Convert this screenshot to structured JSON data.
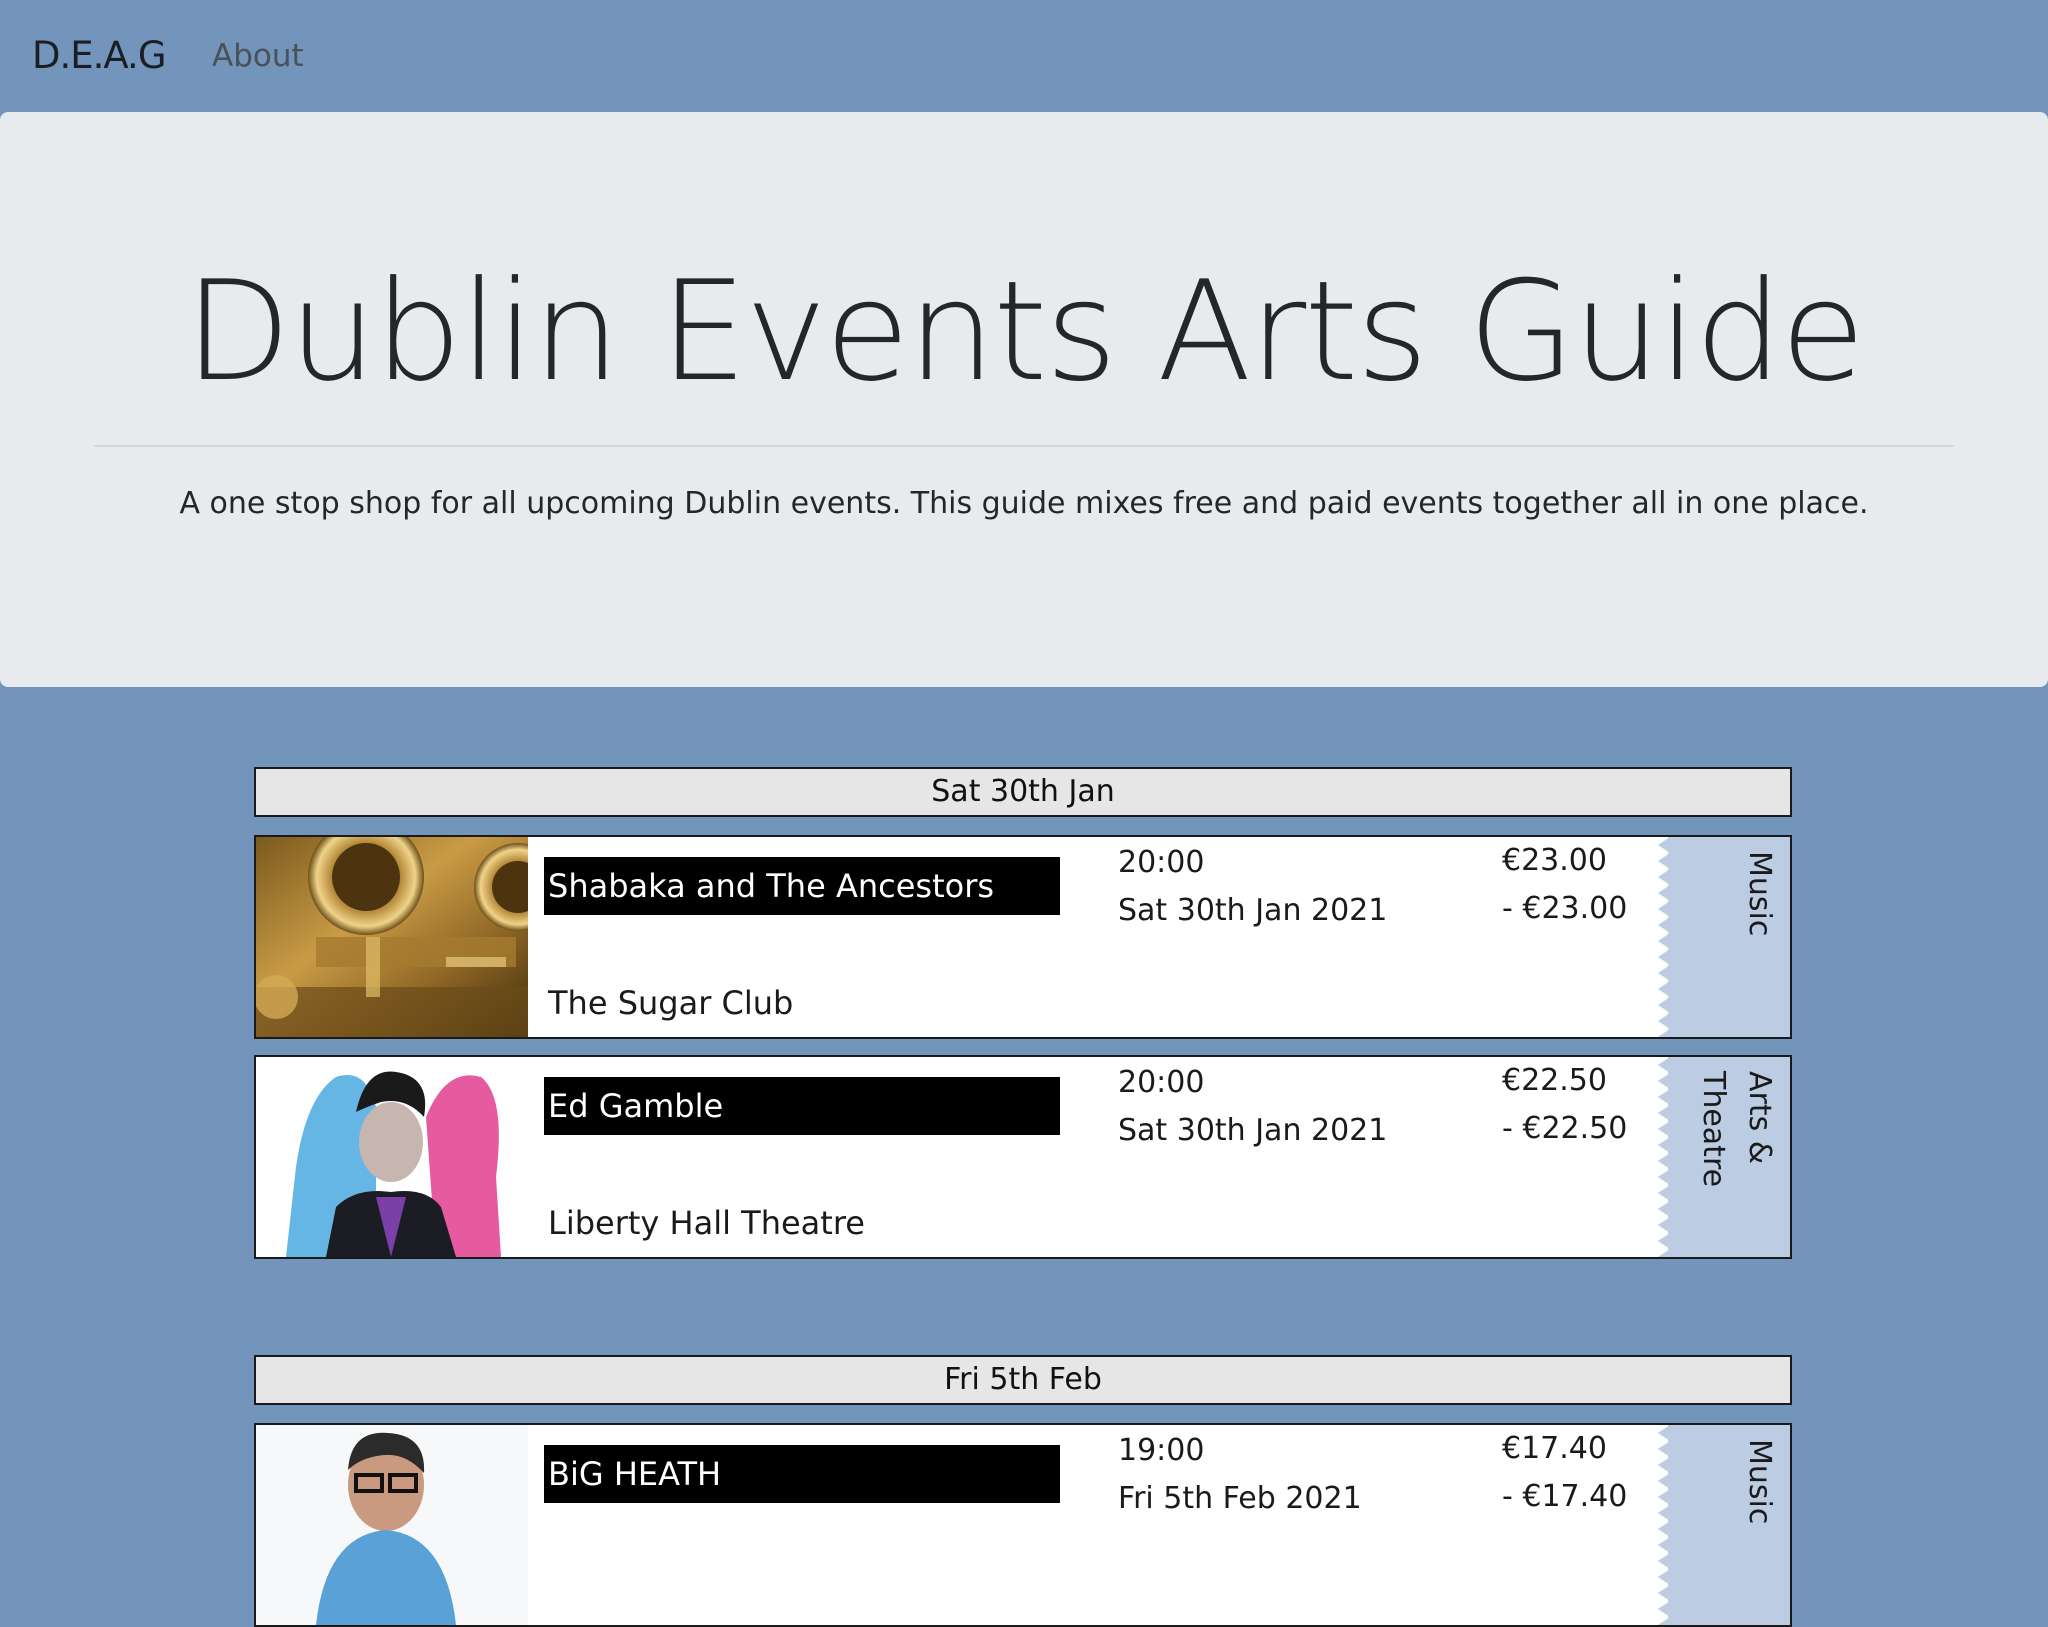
{
  "nav": {
    "brand": "D.E.A.G",
    "about": "About"
  },
  "hero": {
    "title": "Dublin Events Arts Guide",
    "lead": "A one stop shop for all upcoming Dublin events. This guide mixes free and paid events together all in one place."
  },
  "groups": [
    {
      "date_label": "Sat 30th Jan",
      "events": [
        {
          "name": "Shabaka and The Ancestors",
          "venue": "The Sugar Club",
          "time": "20:00",
          "date": "Sat 30th Jan 2021",
          "price_low": "€23.00",
          "price_high": "- €23.00",
          "category": "Music",
          "image": "saxophone-photo"
        },
        {
          "name": "Ed Gamble",
          "venue": "Liberty Hall Theatre",
          "time": "20:00",
          "date": "Sat 30th Jan 2021",
          "price_low": "€22.50",
          "price_high": "- €22.50",
          "category": "Arts & Theatre",
          "image": "comedian-portrait"
        }
      ]
    },
    {
      "date_label": "Fri 5th Feb",
      "events": [
        {
          "name": "BiG HEATH",
          "venue": "",
          "time": "19:00",
          "date": "Fri 5th Feb 2021",
          "price_low": "€17.40",
          "price_high": "- €17.40",
          "category": "Music",
          "image": "artist-portrait"
        }
      ]
    }
  ],
  "colors": {
    "page_background": "#7394bb",
    "jumbotron_background": "#e8ebee",
    "ticket_stub": "#bccde3",
    "name_banner": "#000000"
  }
}
